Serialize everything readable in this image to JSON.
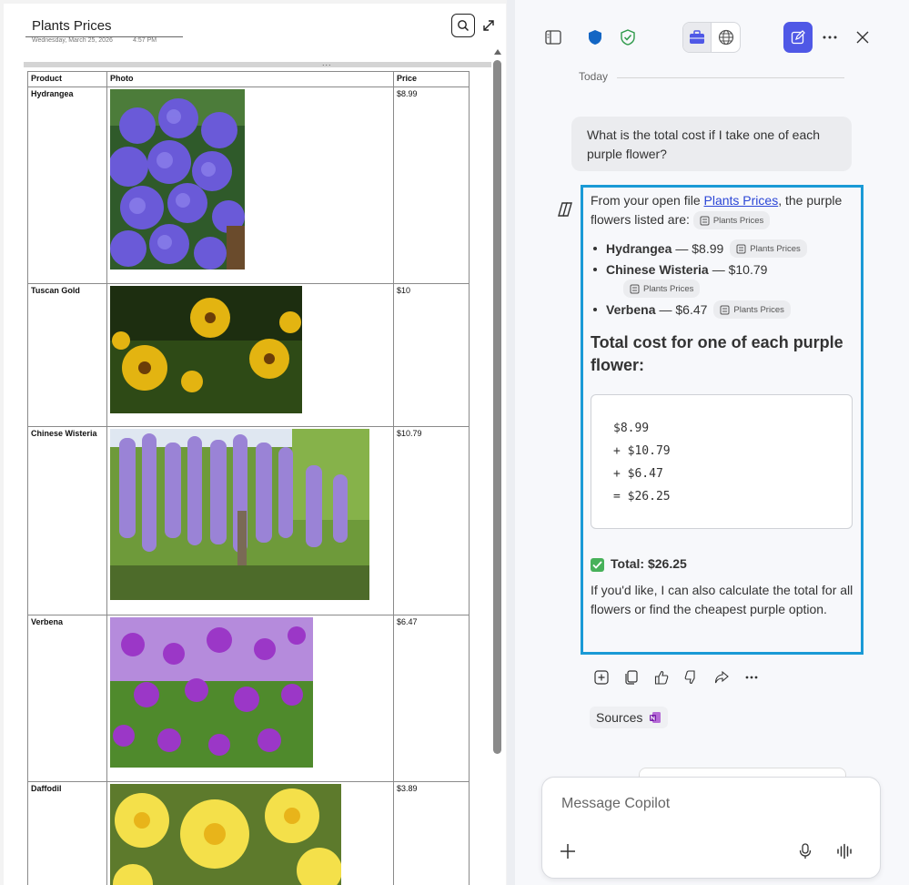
{
  "note": {
    "title": "Plants Prices",
    "date": "Wednesday, March 25, 2026",
    "time": "4:57 PM",
    "grip": "...",
    "table": {
      "headers": [
        "Product",
        "Photo",
        "Price"
      ],
      "rows": [
        {
          "product": "Hydrangea",
          "price": "$8.99",
          "photo": "hydrangea-photo"
        },
        {
          "product": "Tuscan Gold",
          "price": "$10",
          "photo": "tuscan-gold-photo"
        },
        {
          "product": "Chinese Wisteria",
          "price": "$10.79",
          "photo": "chinese-wisteria-photo"
        },
        {
          "product": "Verbena",
          "price": "$6.47",
          "photo": "verbena-photo"
        },
        {
          "product": "Daffodil",
          "price": "$3.89",
          "photo": "daffodil-photo"
        }
      ]
    }
  },
  "copilot": {
    "header_icons": [
      "sidebar-icon",
      "shield-icon",
      "shield-check-icon",
      "briefcase-icon",
      "globe-icon",
      "new-chat-icon",
      "more-icon",
      "close-icon"
    ],
    "today_label": "Today",
    "user_message": "What is the total cost if I take one of each purple flower?",
    "answer": {
      "intro_prefix": "From your open file ",
      "intro_link": "Plants Prices",
      "intro_suffix": ", the purple flowers listed are:",
      "chip_label": "Plants Prices",
      "items": [
        {
          "name": "Hydrangea",
          "price": "— $8.99"
        },
        {
          "name": "Chinese Wisteria",
          "price": "— $10.79"
        },
        {
          "name": "Verbena",
          "price": "— $6.47"
        }
      ],
      "heading": "Total cost for one of each purple flower:",
      "calc_lines": [
        "$8.99",
        "+ $10.79",
        "+ $6.47",
        "= $26.25"
      ],
      "total": "Total: $26.25",
      "followup": "If you'd like, I can also calculate the total for all flowers or find the cheapest purple option."
    },
    "action_icons": [
      "add-icon",
      "copy-icon",
      "thumbs-up-icon",
      "thumbs-down-icon",
      "share-icon",
      "more-icon"
    ],
    "sources_label": "Sources",
    "composer_placeholder": "Message Copilot"
  }
}
